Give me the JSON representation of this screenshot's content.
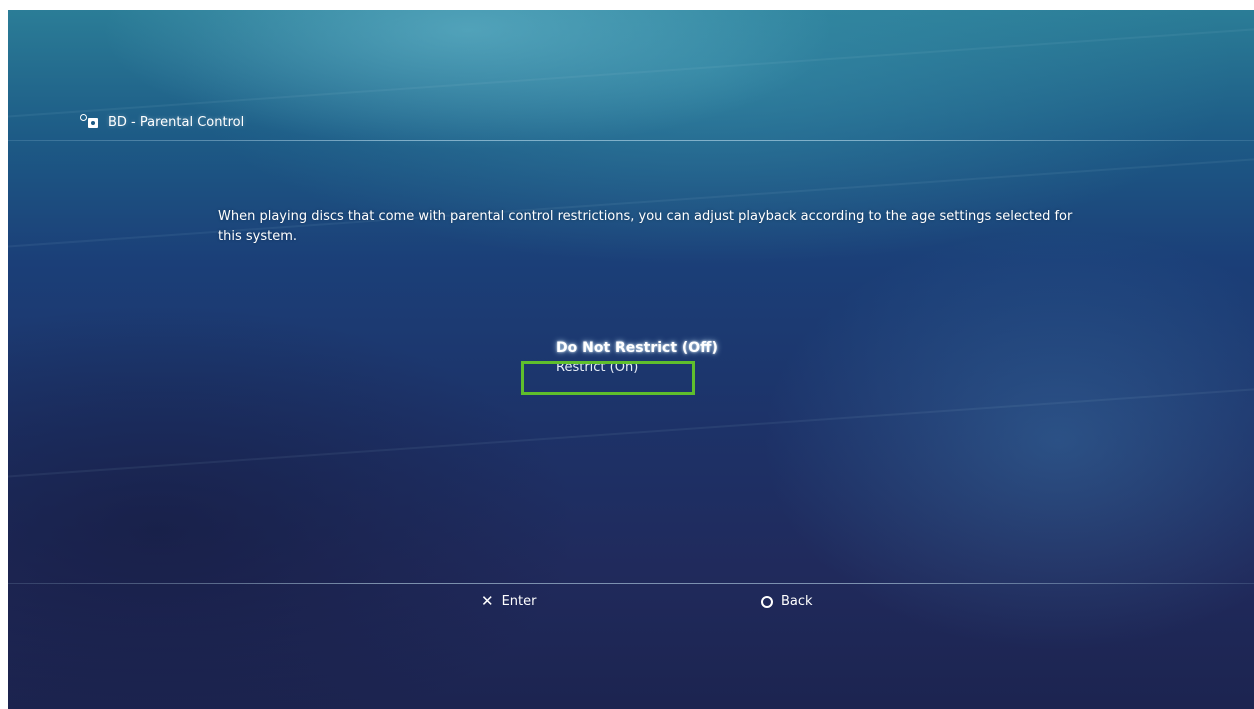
{
  "header": {
    "icon": "parental-control-icon",
    "title": "BD - Parental Control"
  },
  "description": "When playing discs that come with parental control restrictions, you can adjust playback according to the age settings selected for this system.",
  "options": [
    {
      "label": "Do Not Restrict (Off)",
      "selected": true
    },
    {
      "label": "Restrict (On)",
      "selected": false
    }
  ],
  "footer": {
    "enter": {
      "icon": "cross-button-icon",
      "label": "Enter"
    },
    "back": {
      "icon": "circle-button-icon",
      "label": "Back"
    }
  },
  "colors": {
    "highlight_box": "#5fbf2c",
    "background_top": "#2b7d97",
    "background_bottom": "#1c2450"
  }
}
